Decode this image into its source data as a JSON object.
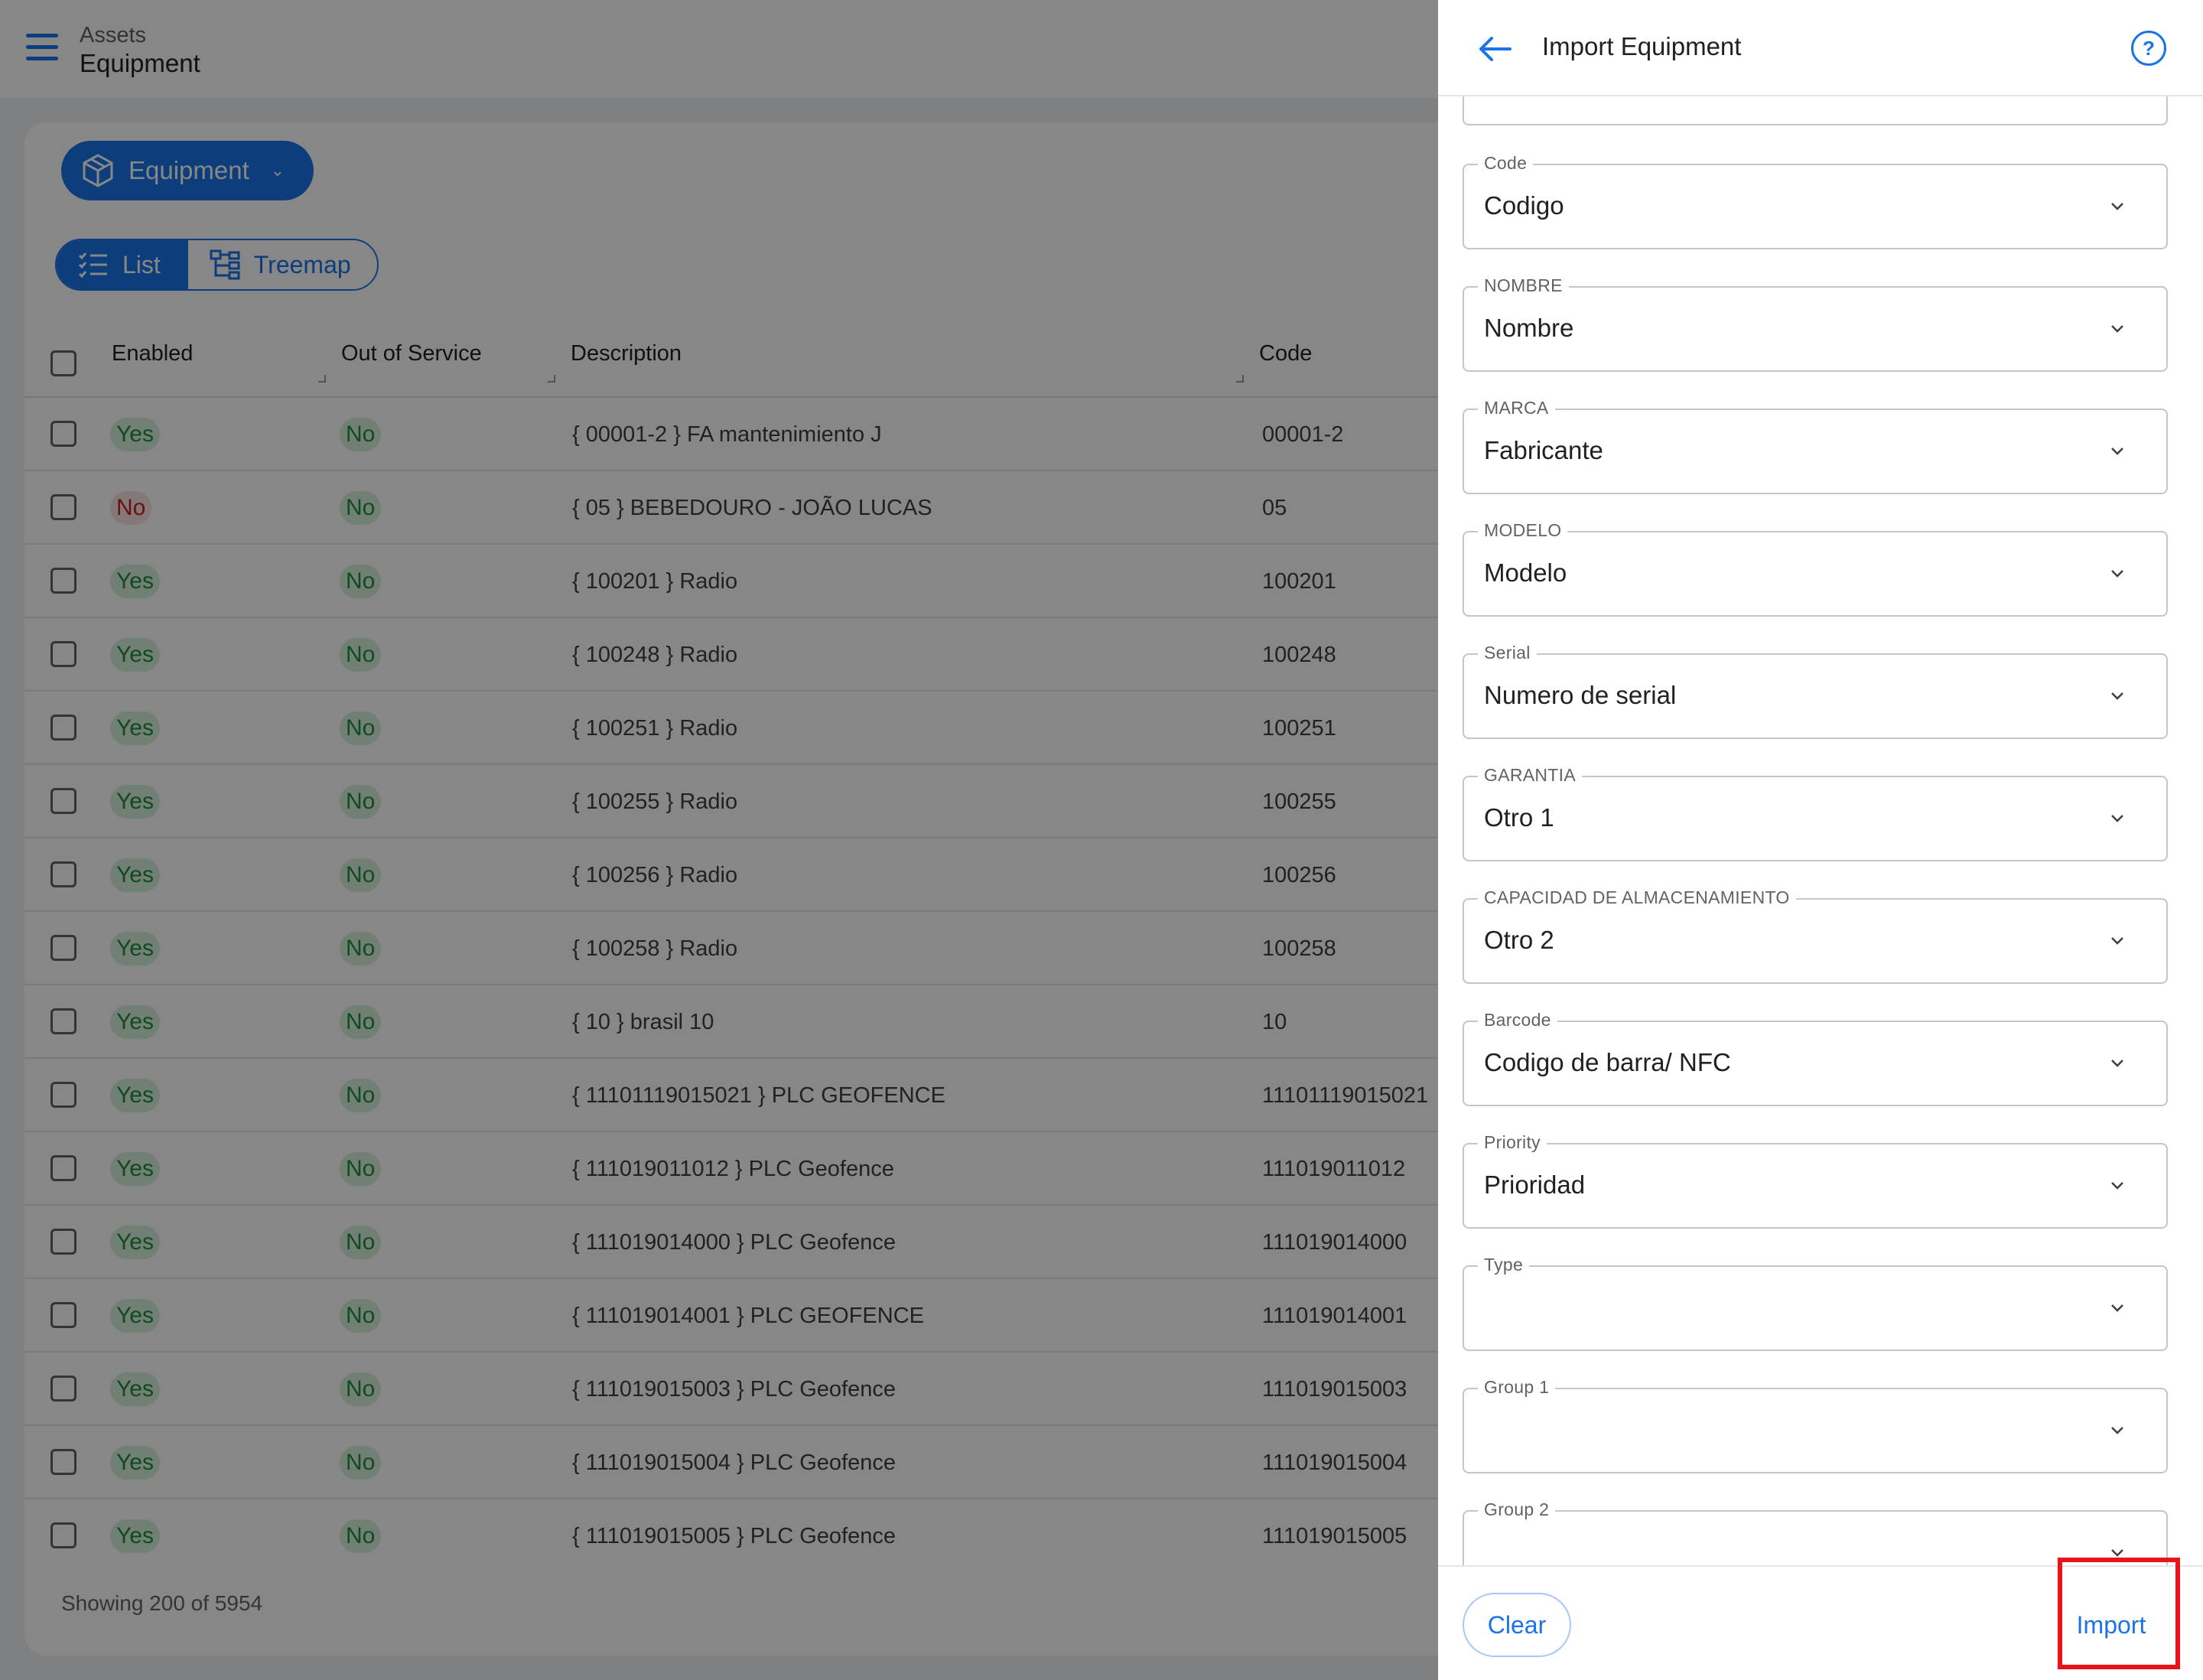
{
  "header": {
    "breadcrumb_parent": "Assets",
    "breadcrumb_title": "Equipment"
  },
  "toolbar": {
    "entity_label": "Equipment",
    "view_list": "List",
    "view_treemap": "Treemap"
  },
  "table": {
    "columns": {
      "enabled": "Enabled",
      "out_of_service": "Out of Service",
      "description": "Description",
      "code": "Code"
    },
    "rows": [
      {
        "enabled": "Yes",
        "oos": "No",
        "description": "{ 00001-2 } FA mantenimiento J",
        "code": "00001-2"
      },
      {
        "enabled": "No",
        "oos": "No",
        "description": "{ 05 } BEBEDOURO - JOÃO LUCAS",
        "code": "05"
      },
      {
        "enabled": "Yes",
        "oos": "No",
        "description": "{ 100201 } Radio",
        "code": "100201"
      },
      {
        "enabled": "Yes",
        "oos": "No",
        "description": "{ 100248 } Radio",
        "code": "100248"
      },
      {
        "enabled": "Yes",
        "oos": "No",
        "description": "{ 100251 } Radio",
        "code": "100251"
      },
      {
        "enabled": "Yes",
        "oos": "No",
        "description": "{ 100255 } Radio",
        "code": "100255"
      },
      {
        "enabled": "Yes",
        "oos": "No",
        "description": "{ 100256 } Radio",
        "code": "100256"
      },
      {
        "enabled": "Yes",
        "oos": "No",
        "description": "{ 100258 } Radio",
        "code": "100258"
      },
      {
        "enabled": "Yes",
        "oos": "No",
        "description": "{ 10 } brasil 10",
        "code": "10"
      },
      {
        "enabled": "Yes",
        "oos": "No",
        "description": "{ 11101119015021 } PLC GEOFENCE",
        "code": "11101119015021"
      },
      {
        "enabled": "Yes",
        "oos": "No",
        "description": "{ 111019011012 } PLC Geofence",
        "code": "111019011012"
      },
      {
        "enabled": "Yes",
        "oos": "No",
        "description": "{ 111019014000 } PLC Geofence",
        "code": "111019014000"
      },
      {
        "enabled": "Yes",
        "oos": "No",
        "description": "{ 111019014001 } PLC GEOFENCE",
        "code": "111019014001"
      },
      {
        "enabled": "Yes",
        "oos": "No",
        "description": "{ 111019015003 } PLC Geofence",
        "code": "111019015003"
      },
      {
        "enabled": "Yes",
        "oos": "No",
        "description": "{ 111019015004 } PLC Geofence",
        "code": "111019015004"
      },
      {
        "enabled": "Yes",
        "oos": "No",
        "description": "{ 111019015005 } PLC Geofence",
        "code": "111019015005"
      }
    ],
    "footer": "Showing 200 of 5954"
  },
  "panel": {
    "title": "Import Equipment",
    "help_label": "?",
    "fields": [
      {
        "label": "Code",
        "value": "Codigo"
      },
      {
        "label": "NOMBRE",
        "value": "Nombre"
      },
      {
        "label": "MARCA",
        "value": "Fabricante"
      },
      {
        "label": "MODELO",
        "value": "Modelo"
      },
      {
        "label": "Serial",
        "value": "Numero de serial"
      },
      {
        "label": "GARANTIA",
        "value": "Otro 1"
      },
      {
        "label": "CAPACIDAD DE ALMACENAMIENTO",
        "value": "Otro 2"
      },
      {
        "label": "Barcode",
        "value": "Codigo de barra/ NFC"
      },
      {
        "label": "Priority",
        "value": "Prioridad"
      },
      {
        "label": "Type",
        "value": ""
      },
      {
        "label": "Group 1",
        "value": ""
      },
      {
        "label": "Group 2",
        "value": ""
      }
    ],
    "clear_label": "Clear",
    "import_label": "Import"
  },
  "colors": {
    "accent": "#1a73e8",
    "success": "#1e8e3e",
    "danger": "#c5221f",
    "highlight": "#e8141c"
  },
  "icons": {
    "menu": "menu-icon",
    "entity": "cube-icon",
    "list": "list-icon",
    "treemap": "treemap-icon",
    "back": "arrow-left-icon",
    "help": "help-circle-icon",
    "chevron": "chevron-down-icon"
  }
}
